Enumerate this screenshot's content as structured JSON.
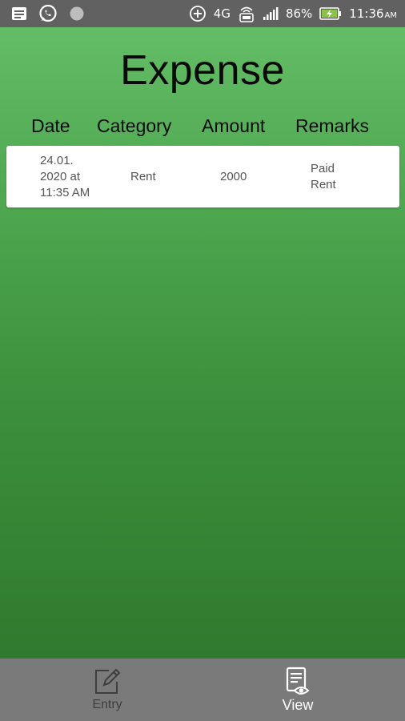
{
  "status_bar": {
    "battery": "86%",
    "time": "11:36",
    "time_suffix": "AM",
    "network": "4G",
    "icons": [
      "notification-icon",
      "whatsapp-icon",
      "circle-icon",
      "data-saver-icon",
      "network-4g-icon",
      "volte-icon",
      "signal-icon",
      "battery-charging-icon"
    ]
  },
  "page": {
    "title": "Expense"
  },
  "table": {
    "headers": {
      "date": "Date",
      "category": "Category",
      "amount": "Amount",
      "remarks": "Remarks"
    },
    "rows": [
      {
        "date_line1": "24.01.",
        "date_line2": "2020 at",
        "date_line3": "11:35 AM",
        "category": "Rent",
        "amount": "2000",
        "remarks_line1": "Paid",
        "remarks_line2": "Rent"
      }
    ]
  },
  "bottom_nav": {
    "entry_label": "Entry",
    "view_label": "View",
    "active": "view"
  },
  "colors": {
    "status_bar": "#616161",
    "green_top": "#63bd66",
    "green_bottom": "#2f7a2e",
    "bottom_nav": "#7a7a7a"
  }
}
